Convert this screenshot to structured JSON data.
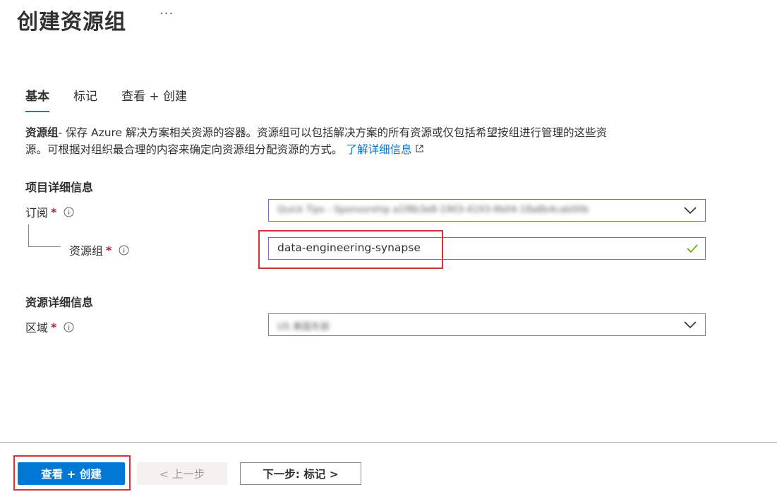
{
  "header": {
    "title": "创建资源组",
    "more": "···"
  },
  "tabs": [
    {
      "label": "基本",
      "active": true
    },
    {
      "label": "标记",
      "active": false
    },
    {
      "label": "查看 + 创建",
      "active": false
    }
  ],
  "description": {
    "term": "资源组",
    "line1_rest": "- 保存 Azure 解决方案相关资源的容器。资源组可以包括解决方案的所有资源或仅包括希望按组进行管理的这些资",
    "line2": "源。可根据对组织最合理的内容来确定向资源组分配资源的方式。",
    "learn_more": "了解详细信息"
  },
  "project_details": {
    "heading": "项目详细信息",
    "subscription": {
      "label": "订阅",
      "required": "*",
      "value": "Quick Tips - Sponsorship a1f8b3e8-1903-4193-9b04-18a8b4cab00b"
    },
    "resource_group": {
      "label": "资源组",
      "required": "*",
      "value": "data-engineering-synapse"
    }
  },
  "resource_details": {
    "heading": "资源详细信息",
    "region": {
      "label": "区域",
      "required": "*",
      "value": "US 美国东部"
    }
  },
  "footer": {
    "review_create": "查看 + 创建",
    "previous": "< 上一步",
    "next": "下一步: 标记 >"
  },
  "colors": {
    "accent": "#0078d4",
    "highlight": "#d13438",
    "focus_border": "#8764b8",
    "valid": "#57a300"
  }
}
